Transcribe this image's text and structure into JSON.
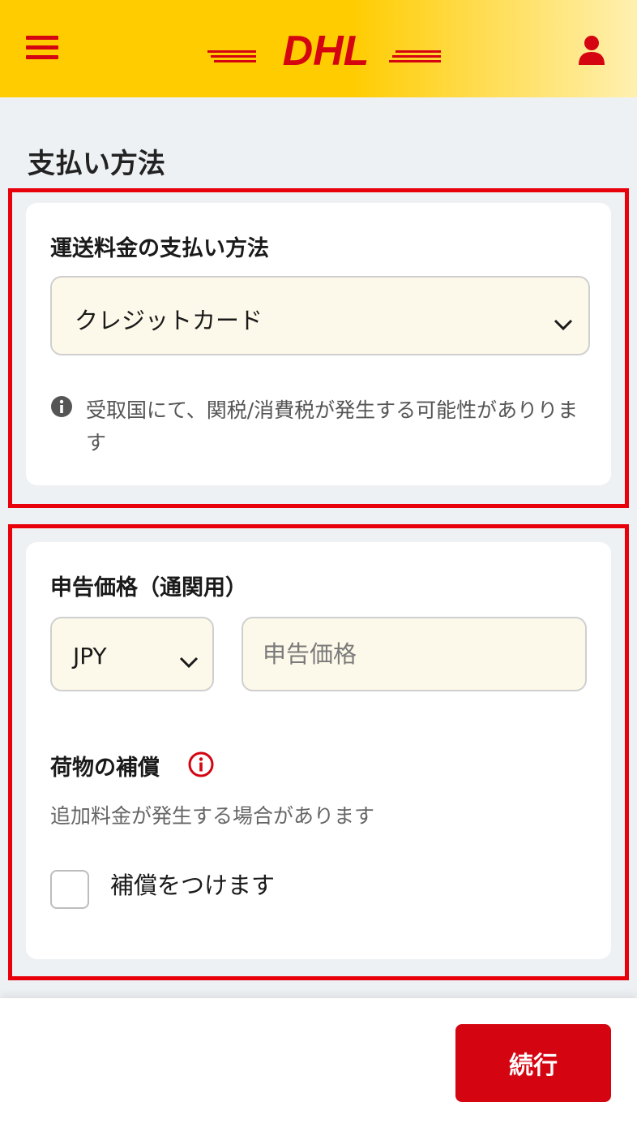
{
  "header": {
    "logo_text": "DHL",
    "menu_icon": "hamburger-menu-icon",
    "user_icon": "user-icon",
    "brand_red": "#d40511",
    "brand_yellow": "#ffcc00"
  },
  "page": {
    "title": "支払い方法"
  },
  "payment_section": {
    "label": "運送料金の支払い方法",
    "method_value": "クレジットカード",
    "info_text": "受取国にて、関税/消費税が発生する可能性がありります"
  },
  "declared_section": {
    "label": "申告価格（通関用）",
    "currency_value": "JPY",
    "amount_placeholder": "申告価格"
  },
  "insurance_section": {
    "label": "荷物の補償",
    "note": "追加料金が発生する場合があります",
    "checkbox_label": "補償をつけます"
  },
  "footer": {
    "continue_label": "続行"
  }
}
